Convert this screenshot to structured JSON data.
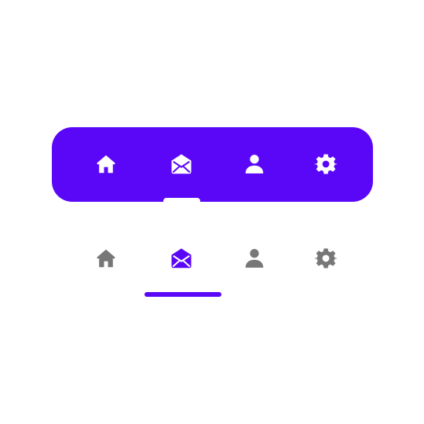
{
  "colors": {
    "accent": "#5b07f7",
    "active_icon_filled": "#ffffff",
    "inactive_icon_plain": "#777777",
    "active_icon_plain": "#5b07f7"
  },
  "filled_nav": {
    "items": [
      {
        "icon": "home-icon",
        "active": false
      },
      {
        "icon": "mail-open-icon",
        "active": true
      },
      {
        "icon": "user-icon",
        "active": false
      },
      {
        "icon": "gear-icon",
        "active": false
      }
    ]
  },
  "plain_nav": {
    "items": [
      {
        "icon": "home-icon",
        "active": false
      },
      {
        "icon": "mail-open-icon",
        "active": true
      },
      {
        "icon": "user-icon",
        "active": false
      },
      {
        "icon": "gear-icon",
        "active": false
      }
    ]
  }
}
